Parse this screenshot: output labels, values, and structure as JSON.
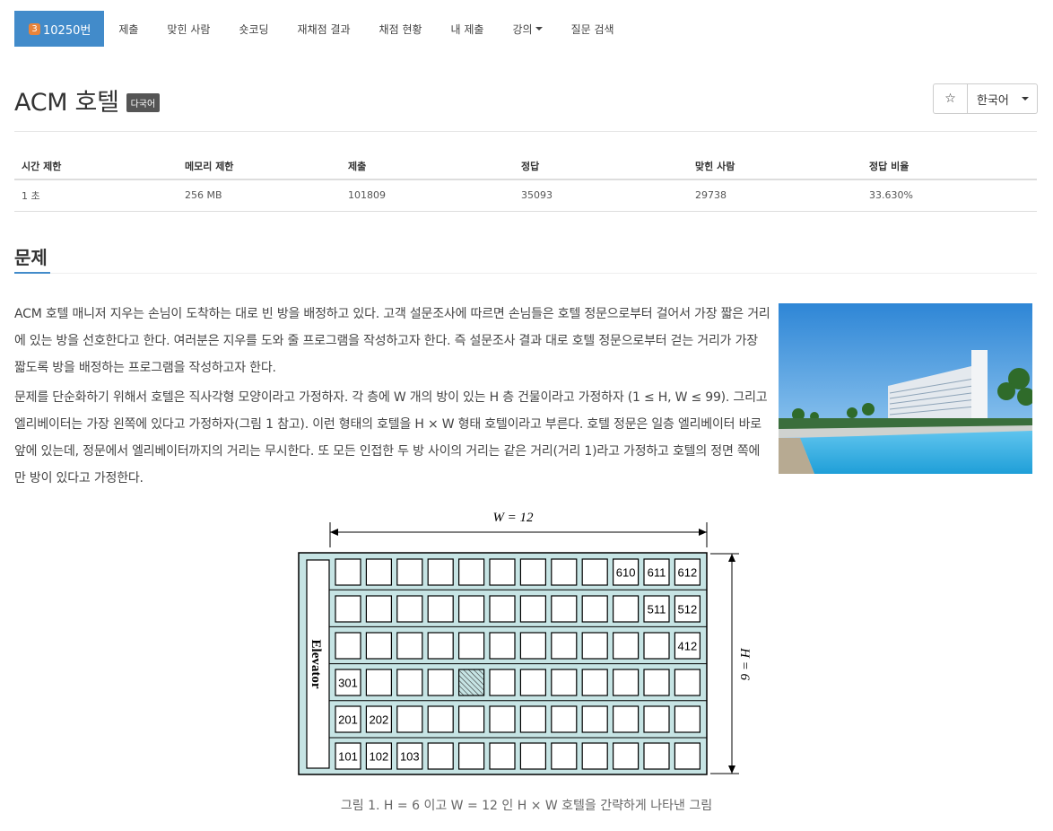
{
  "nav": {
    "problem_badge": "3",
    "problem_number": "10250번",
    "items": [
      "제출",
      "맞힌 사람",
      "숏코딩",
      "재채점 결과",
      "채점 현황",
      "내 제출",
      "강의",
      "질문 검색"
    ]
  },
  "problem": {
    "title": "ACM 호텔",
    "lang_badge": "다국어",
    "star_icon": "☆",
    "language": "한국어"
  },
  "info_table": {
    "headers": [
      "시간 제한",
      "메모리 제한",
      "제출",
      "정답",
      "맞힌 사람",
      "정답 비율"
    ],
    "values": [
      "1 초",
      "256 MB",
      "101809",
      "35093",
      "29738",
      "33.630%"
    ]
  },
  "section": {
    "title": "문제"
  },
  "description": {
    "p1": "ACM 호텔 매니저 지우는 손님이 도착하는 대로 빈 방을 배정하고 있다. 고객 설문조사에 따르면 손님들은 호텔 정문으로부터 걸어서 가장 짧은 거리에 있는 방을 선호한다고 한다. 여러분은 지우를 도와 줄 프로그램을 작성하고자 한다. 즉 설문조사 결과 대로 호텔 정문으로부터 걷는 거리가 가장 짧도록 방을 배정하는 프로그램을 작성하고자 한다.",
    "p2": "문제를 단순화하기 위해서 호텔은 직사각형 모양이라고 가정하자. 각 층에 W 개의 방이 있는 H 층 건물이라고 가정하자 (1 ≤ H, W ≤ 99). 그리고 엘리베이터는 가장 왼쪽에 있다고 가정하자(그림 1 참고). 이런 형태의 호텔을 H × W 형태 호텔이라고 부른다. 호텔 정문은 일층 엘리베이터 바로 앞에 있는데, 정문에서 엘리베이터까지의 거리는 무시한다. 또 모든 인접한 두 방 사이의 거리는 같은 거리(거리 1)라고 가정하고 호텔의 정면 쪽에만 방이 있다고 가정한다."
  },
  "figure": {
    "w_label": "W = 12",
    "h_label": "H = 6",
    "elevator_label": "Elevator",
    "rooms": [
      {
        "floor": 6,
        "col": 10,
        "label": "610"
      },
      {
        "floor": 6,
        "col": 11,
        "label": "611"
      },
      {
        "floor": 6,
        "col": 12,
        "label": "612"
      },
      {
        "floor": 5,
        "col": 11,
        "label": "511"
      },
      {
        "floor": 5,
        "col": 12,
        "label": "512"
      },
      {
        "floor": 4,
        "col": 12,
        "label": "412"
      },
      {
        "floor": 3,
        "col": 1,
        "label": "301"
      },
      {
        "floor": 2,
        "col": 1,
        "label": "201"
      },
      {
        "floor": 2,
        "col": 2,
        "label": "202"
      },
      {
        "floor": 1,
        "col": 1,
        "label": "101"
      },
      {
        "floor": 1,
        "col": 2,
        "label": "102"
      },
      {
        "floor": 1,
        "col": 3,
        "label": "103"
      }
    ],
    "hatched_room": {
      "floor": 3,
      "col": 5
    },
    "caption": "그림 1. H = 6 이고 W = 12 인 H × W 호텔을 간략하게 나타낸 그림"
  },
  "colors": {
    "nav_active": "#428bca",
    "badge": "#e9843b",
    "floor_fill": "#c6e4e4"
  }
}
